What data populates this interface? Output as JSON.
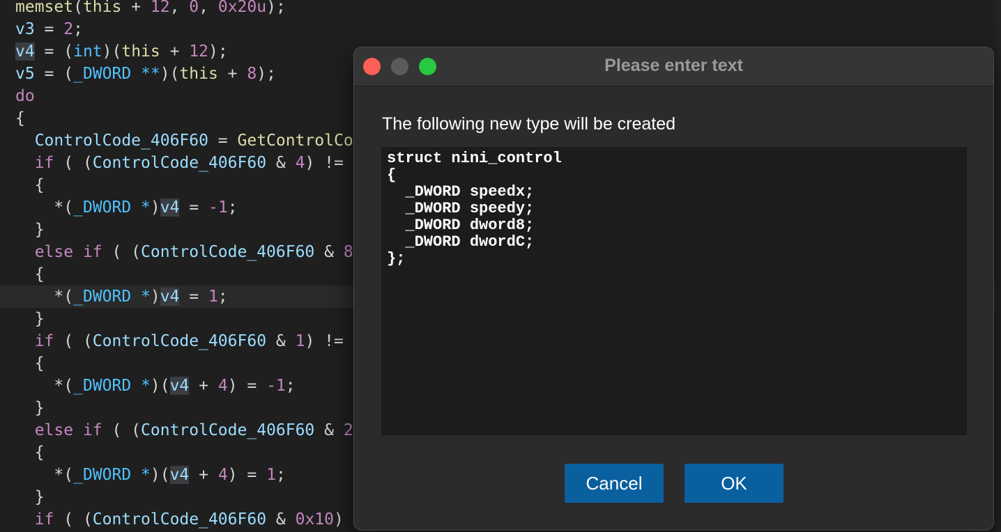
{
  "editor": {
    "lines": [
      [
        {
          "t": "memset",
          "c": "func"
        },
        {
          "t": "(",
          "c": "plain"
        },
        {
          "t": "this",
          "c": "func"
        },
        {
          "t": " + ",
          "c": "plain"
        },
        {
          "t": "12",
          "c": "num"
        },
        {
          "t": ", ",
          "c": "plain"
        },
        {
          "t": "0",
          "c": "num"
        },
        {
          "t": ", ",
          "c": "plain"
        },
        {
          "t": "0x20u",
          "c": "num"
        },
        {
          "t": ");",
          "c": "plain"
        }
      ],
      [
        {
          "t": "v3",
          "c": "var"
        },
        {
          "t": " = ",
          "c": "plain"
        },
        {
          "t": "2",
          "c": "num"
        },
        {
          "t": ";",
          "c": "plain"
        }
      ],
      [
        {
          "t": "v4",
          "c": "hl"
        },
        {
          "t": " = (",
          "c": "plain"
        },
        {
          "t": "int",
          "c": "type"
        },
        {
          "t": ")(",
          "c": "plain"
        },
        {
          "t": "this",
          "c": "func"
        },
        {
          "t": " + ",
          "c": "plain"
        },
        {
          "t": "12",
          "c": "num"
        },
        {
          "t": ");",
          "c": "plain"
        }
      ],
      [
        {
          "t": "v5",
          "c": "var"
        },
        {
          "t": " = (",
          "c": "plain"
        },
        {
          "t": "_DWORD **",
          "c": "type"
        },
        {
          "t": ")(",
          "c": "plain"
        },
        {
          "t": "this",
          "c": "func"
        },
        {
          "t": " + ",
          "c": "plain"
        },
        {
          "t": "8",
          "c": "num"
        },
        {
          "t": ");",
          "c": "plain"
        }
      ],
      [
        {
          "t": "do",
          "c": "kw"
        }
      ],
      [
        {
          "t": "{",
          "c": "plain"
        }
      ],
      [
        {
          "t": "  ",
          "c": "plain"
        },
        {
          "t": "ControlCode_406F60",
          "c": "var"
        },
        {
          "t": " = ",
          "c": "plain"
        },
        {
          "t": "GetControlCode",
          "c": "func"
        }
      ],
      [
        {
          "t": "  ",
          "c": "plain"
        },
        {
          "t": "if",
          "c": "kw"
        },
        {
          "t": " ( (",
          "c": "plain"
        },
        {
          "t": "ControlCode_406F60",
          "c": "var"
        },
        {
          "t": " & ",
          "c": "plain"
        },
        {
          "t": "4",
          "c": "num"
        },
        {
          "t": ") != ",
          "c": "plain"
        }
      ],
      [
        {
          "t": "  {",
          "c": "plain"
        }
      ],
      [
        {
          "t": "    *(",
          "c": "plain"
        },
        {
          "t": "_DWORD *",
          "c": "type"
        },
        {
          "t": ")",
          "c": "plain"
        },
        {
          "t": "v4",
          "c": "hl"
        },
        {
          "t": " = ",
          "c": "plain"
        },
        {
          "t": "-1",
          "c": "num"
        },
        {
          "t": ";",
          "c": "plain"
        }
      ],
      [
        {
          "t": "  }",
          "c": "plain"
        }
      ],
      [
        {
          "t": "  ",
          "c": "plain"
        },
        {
          "t": "else if",
          "c": "kw"
        },
        {
          "t": " ( (",
          "c": "plain"
        },
        {
          "t": "ControlCode_406F60",
          "c": "var"
        },
        {
          "t": " & ",
          "c": "plain"
        },
        {
          "t": "8",
          "c": "num"
        }
      ],
      [
        {
          "t": "  {",
          "c": "plain"
        }
      ],
      [
        {
          "t": "    *(",
          "c": "plain"
        },
        {
          "t": "_DWORD *",
          "c": "type"
        },
        {
          "t": ")",
          "c": "plain"
        },
        {
          "t": "v4",
          "c": "hl"
        },
        {
          "t": " = ",
          "c": "plain"
        },
        {
          "t": "1",
          "c": "num"
        },
        {
          "t": ";",
          "c": "plain"
        }
      ],
      [
        {
          "t": "  }",
          "c": "plain"
        }
      ],
      [
        {
          "t": "  ",
          "c": "plain"
        },
        {
          "t": "if",
          "c": "kw"
        },
        {
          "t": " ( (",
          "c": "plain"
        },
        {
          "t": "ControlCode_406F60",
          "c": "var"
        },
        {
          "t": " & ",
          "c": "plain"
        },
        {
          "t": "1",
          "c": "num"
        },
        {
          "t": ") != ",
          "c": "plain"
        }
      ],
      [
        {
          "t": "  {",
          "c": "plain"
        }
      ],
      [
        {
          "t": "    *(",
          "c": "plain"
        },
        {
          "t": "_DWORD *",
          "c": "type"
        },
        {
          "t": ")(",
          "c": "plain"
        },
        {
          "t": "v4",
          "c": "hl"
        },
        {
          "t": " + ",
          "c": "plain"
        },
        {
          "t": "4",
          "c": "num"
        },
        {
          "t": ") = ",
          "c": "plain"
        },
        {
          "t": "-1",
          "c": "num"
        },
        {
          "t": ";",
          "c": "plain"
        }
      ],
      [
        {
          "t": "  }",
          "c": "plain"
        }
      ],
      [
        {
          "t": "  ",
          "c": "plain"
        },
        {
          "t": "else if",
          "c": "kw"
        },
        {
          "t": " ( (",
          "c": "plain"
        },
        {
          "t": "ControlCode_406F60",
          "c": "var"
        },
        {
          "t": " & ",
          "c": "plain"
        },
        {
          "t": "2",
          "c": "num"
        }
      ],
      [
        {
          "t": "  {",
          "c": "plain"
        }
      ],
      [
        {
          "t": "    *(",
          "c": "plain"
        },
        {
          "t": "_DWORD *",
          "c": "type"
        },
        {
          "t": ")(",
          "c": "plain"
        },
        {
          "t": "v4",
          "c": "hl"
        },
        {
          "t": " + ",
          "c": "plain"
        },
        {
          "t": "4",
          "c": "num"
        },
        {
          "t": ") = ",
          "c": "plain"
        },
        {
          "t": "1",
          "c": "num"
        },
        {
          "t": ";",
          "c": "plain"
        }
      ],
      [
        {
          "t": "  }",
          "c": "plain"
        }
      ],
      [
        {
          "t": "  ",
          "c": "plain"
        },
        {
          "t": "if",
          "c": "kw"
        },
        {
          "t": " ( (",
          "c": "plain"
        },
        {
          "t": "ControlCode_406F60",
          "c": "var"
        },
        {
          "t": " & ",
          "c": "plain"
        },
        {
          "t": "0x10",
          "c": "num"
        },
        {
          "t": ")",
          "c": "plain"
        }
      ]
    ],
    "current_line_index": 13
  },
  "dialog": {
    "title": "Please enter text",
    "prompt": "The following new type will be created",
    "text": "struct nini_control\n{\n  _DWORD speedx;\n  _DWORD speedy;\n  _DWORD dword8;\n  _DWORD dwordC;\n};",
    "cancel_label": "Cancel",
    "ok_label": "OK"
  },
  "colors": {
    "editor_bg": "#1f1f1f",
    "function": "#dcdcaa",
    "keyword": "#c586c0",
    "variable": "#9cdcfe",
    "type": "#4fc1ff",
    "button_bg": "#0a5f9e",
    "traffic_close": "#fe5f57",
    "traffic_minimize": "#5b5b5b",
    "traffic_maximize": "#28c840"
  },
  "icons": {
    "close": "close-icon",
    "minimize": "minimize-icon",
    "maximize": "maximize-icon"
  }
}
